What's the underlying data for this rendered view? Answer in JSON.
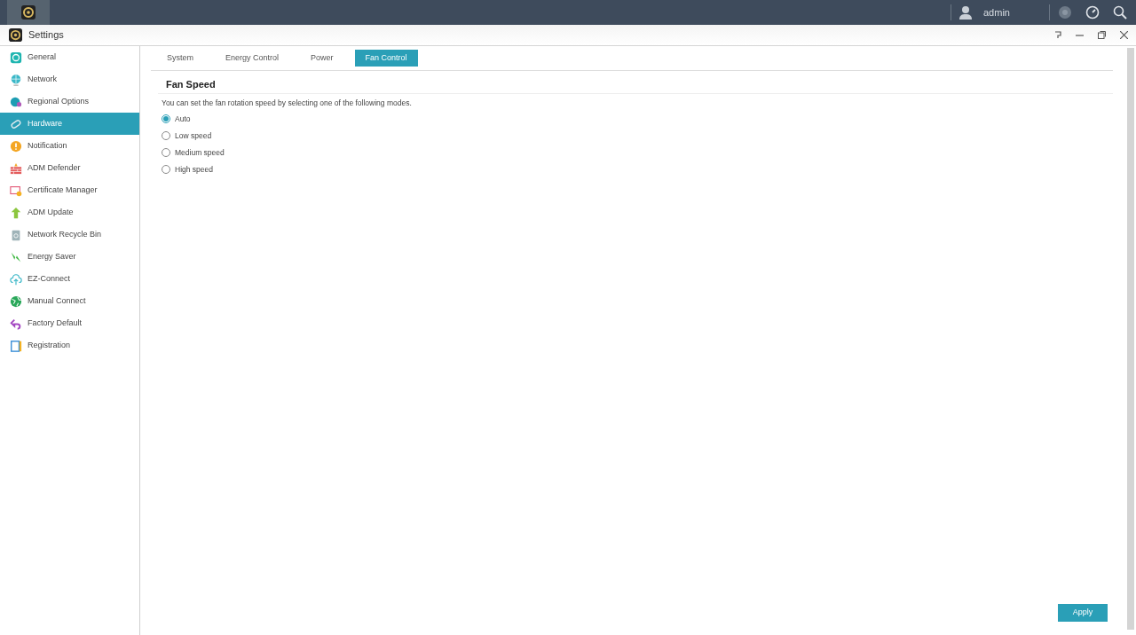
{
  "taskbar": {
    "user": "admin"
  },
  "window": {
    "title": "Settings"
  },
  "sidebar": {
    "items": [
      {
        "label": "General",
        "selected": false
      },
      {
        "label": "Network",
        "selected": false
      },
      {
        "label": "Regional Options",
        "selected": false
      },
      {
        "label": "Hardware",
        "selected": true
      },
      {
        "label": "Notification",
        "selected": false
      },
      {
        "label": "ADM Defender",
        "selected": false
      },
      {
        "label": "Certificate Manager",
        "selected": false
      },
      {
        "label": "ADM Update",
        "selected": false
      },
      {
        "label": "Network Recycle Bin",
        "selected": false
      },
      {
        "label": "Energy Saver",
        "selected": false
      },
      {
        "label": "EZ-Connect",
        "selected": false
      },
      {
        "label": "Manual Connect",
        "selected": false
      },
      {
        "label": "Factory Default",
        "selected": false
      },
      {
        "label": "Registration",
        "selected": false
      }
    ]
  },
  "tabs": [
    {
      "label": "System",
      "selected": false
    },
    {
      "label": "Energy Control",
      "selected": false
    },
    {
      "label": "Power",
      "selected": false
    },
    {
      "label": "Fan Control",
      "selected": true
    }
  ],
  "section": {
    "title": "Fan Speed",
    "description": "You can set the fan rotation speed by selecting one of the following modes.",
    "options": [
      {
        "label": "Auto",
        "selected": true
      },
      {
        "label": "Low speed",
        "selected": false
      },
      {
        "label": "Medium speed",
        "selected": false
      },
      {
        "label": "High speed",
        "selected": false
      }
    ]
  },
  "buttons": [
    "Apply"
  ]
}
